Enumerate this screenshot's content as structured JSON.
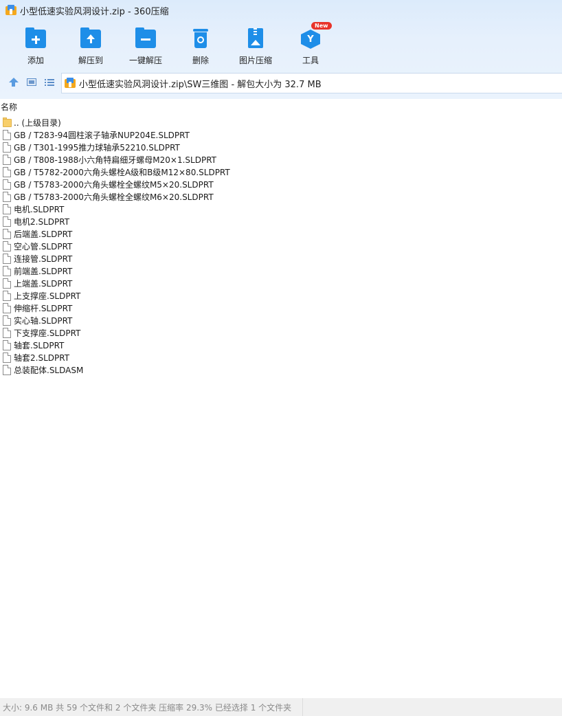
{
  "window": {
    "title": "小型低速实验风洞设计.zip - 360压缩"
  },
  "toolbar": {
    "items": [
      {
        "label": "添加",
        "icon": "add-folder-icon"
      },
      {
        "label": "解压到",
        "icon": "extract-to-icon"
      },
      {
        "label": "一键解压",
        "icon": "one-click-extract-icon"
      },
      {
        "label": "删除",
        "icon": "recycle-bin-icon"
      },
      {
        "label": "图片压缩",
        "icon": "image-compress-icon"
      },
      {
        "label": "工具",
        "icon": "tools-icon",
        "badge": "New"
      }
    ]
  },
  "address": {
    "path": "小型低速实验风洞设计.zip\\SW三维图 - 解包大小为 32.7 MB"
  },
  "list": {
    "column_name": "名称",
    "items": [
      {
        "name": ".. (上级目录)",
        "type": "folder"
      },
      {
        "name": "GB / T283-94圆柱滚子轴承NUP204E.SLDPRT",
        "type": "file"
      },
      {
        "name": "GB / T301-1995推力球轴承52210.SLDPRT",
        "type": "file"
      },
      {
        "name": "GB / T808-1988小六角特扁细牙螺母M20×1.SLDPRT",
        "type": "file"
      },
      {
        "name": "GB / T5782-2000六角头螺栓A级和B级M12×80.SLDPRT",
        "type": "file"
      },
      {
        "name": "GB / T5783-2000六角头螺栓全螺纹M5×20.SLDPRT",
        "type": "file"
      },
      {
        "name": "GB / T5783-2000六角头螺栓全螺纹M6×20.SLDPRT",
        "type": "file"
      },
      {
        "name": "电机.SLDPRT",
        "type": "file"
      },
      {
        "name": "电机2.SLDPRT",
        "type": "file"
      },
      {
        "name": "后端盖.SLDPRT",
        "type": "file"
      },
      {
        "name": "空心管.SLDPRT",
        "type": "file"
      },
      {
        "name": "连接管.SLDPRT",
        "type": "file"
      },
      {
        "name": "前端盖.SLDPRT",
        "type": "file"
      },
      {
        "name": "上端盖.SLDPRT",
        "type": "file"
      },
      {
        "name": "上支撑座.SLDPRT",
        "type": "file"
      },
      {
        "name": "伸缩杆.SLDPRT",
        "type": "file"
      },
      {
        "name": "实心轴.SLDPRT",
        "type": "file"
      },
      {
        "name": "下支撑座.SLDPRT",
        "type": "file"
      },
      {
        "name": "轴套.SLDPRT",
        "type": "file"
      },
      {
        "name": "轴套2.SLDPRT",
        "type": "file"
      },
      {
        "name": "总装配体.SLDASM",
        "type": "file"
      }
    ]
  },
  "status": {
    "text": "大小: 9.6 MB 共 59 个文件和 2 个文件夹 压缩率 29.3% 已经选择 1 个文件夹"
  },
  "colors": {
    "accent": "#1e8ee8",
    "chrome_bg": "#e6f0fc",
    "badge": "#e8332a",
    "folder": "#f8cf6b"
  }
}
